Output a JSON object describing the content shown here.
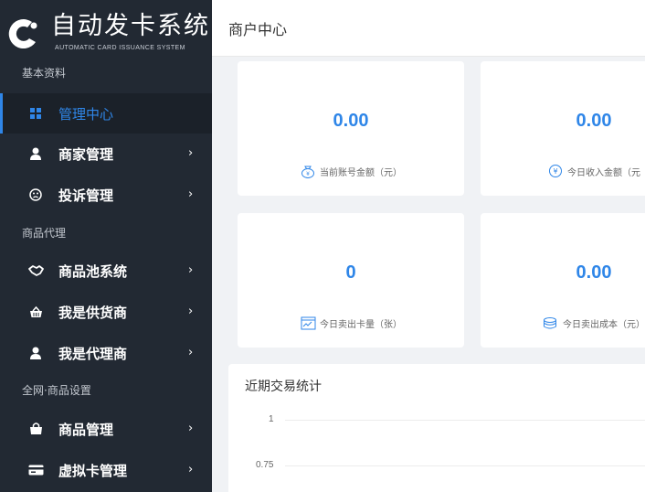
{
  "app": {
    "title": "自动发卡系统",
    "subtitle": "AUTOMATIC CARD ISSUANCE SYSTEM"
  },
  "sidebar": {
    "groups": [
      {
        "title": "基本资料"
      },
      {
        "title": "商品代理"
      },
      {
        "title": "全网·商品设置"
      }
    ],
    "items": [
      {
        "label": "管理中心",
        "icon": "dashboard-icon",
        "active": true
      },
      {
        "label": "商家管理",
        "icon": "user-icon"
      },
      {
        "label": "投诉管理",
        "icon": "complaint-icon"
      },
      {
        "label": "商品池系统",
        "icon": "handshake-icon"
      },
      {
        "label": "我是供货商",
        "icon": "basket-icon"
      },
      {
        "label": "我是代理商",
        "icon": "user-icon"
      },
      {
        "label": "商品管理",
        "icon": "shopping-bag-icon"
      },
      {
        "label": "虚拟卡管理",
        "icon": "card-icon"
      }
    ]
  },
  "header": {
    "title": "商户中心"
  },
  "cards": [
    {
      "value": "0.00",
      "label": "当前账号金额（元）",
      "icon": "money-bag-icon"
    },
    {
      "value": "0.00",
      "label": "今日收入金额（元",
      "icon": "yen-icon"
    },
    {
      "value": "0",
      "label": "今日卖出卡量（张）",
      "icon": "card-sold-icon"
    },
    {
      "value": "0.00",
      "label": "今日卖出成本（元）",
      "icon": "coins-icon"
    }
  ],
  "stats": {
    "title": "近期交易统计",
    "ticks": [
      "1",
      "0.75"
    ]
  },
  "colors": {
    "sidebar_bg": "#222933",
    "accent": "#2f86e8",
    "page_bg": "#f0f2f5"
  }
}
